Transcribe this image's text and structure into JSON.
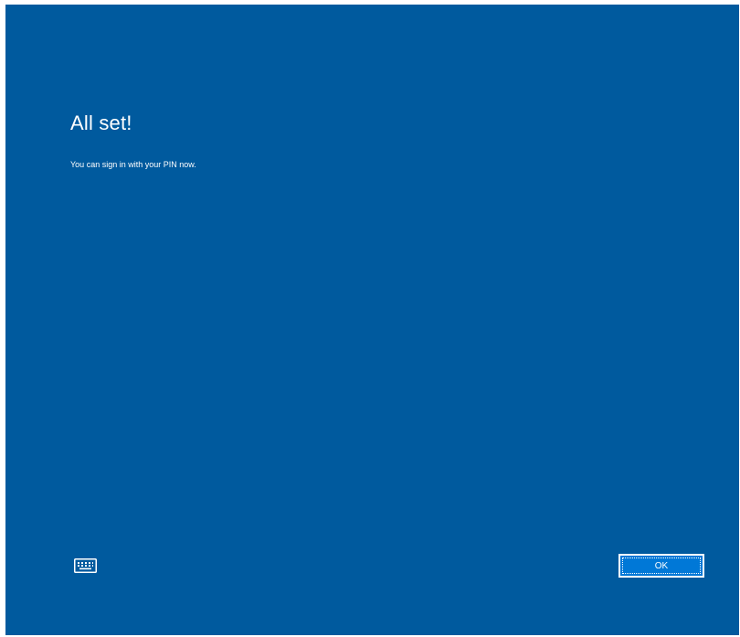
{
  "page": {
    "title": "All set!",
    "message": "You can sign in with your PIN now."
  },
  "footer": {
    "keyboard_icon": "keyboard-icon",
    "ok_label": "OK"
  },
  "colors": {
    "background": "#005a9e",
    "button": "#0078d7",
    "text": "#ffffff"
  }
}
